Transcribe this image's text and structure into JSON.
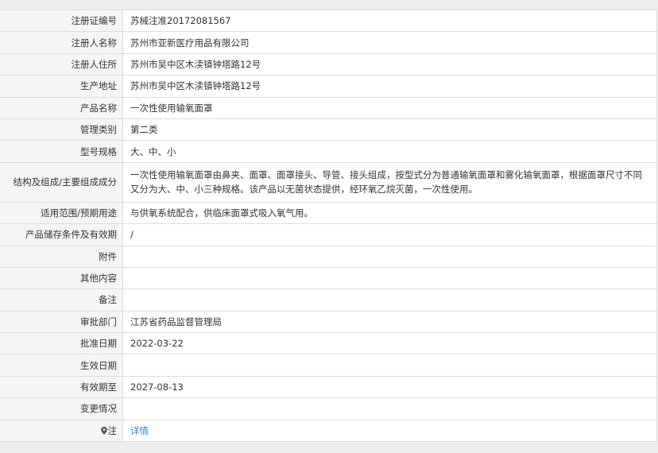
{
  "rows": [
    {
      "label": "注册证编号",
      "value": "苏械注准20172081567"
    },
    {
      "label": "注册人名称",
      "value": "苏州市亚新医疗用品有限公司"
    },
    {
      "label": "注册人住所",
      "value": "苏州市吴中区木渎镇钟塔路12号"
    },
    {
      "label": "生产地址",
      "value": "苏州市吴中区木渎镇钟塔路12号"
    },
    {
      "label": "产品名称",
      "value": "一次性使用输氧面罩"
    },
    {
      "label": "管理类别",
      "value": "第二类"
    },
    {
      "label": "型号规格",
      "value": "大、中、小"
    },
    {
      "label": "结构及组成/主要组成成分",
      "value": "一次性使用输氧面罩由鼻夹、面罩、面罩接头、导管、接头组成，按型式分为普通输氧面罩和雾化输氧面罩，根据面罩尺寸不同又分为大、中、小三种规格。该产品以无菌状态提供，经环氧乙烷灭菌，一次性使用。"
    },
    {
      "label": "适用范围/预期用途",
      "value": "与供氧系统配合，供临床面罩式吸入氧气用。"
    },
    {
      "label": "产品储存条件及有效期",
      "value": "/"
    },
    {
      "label": "附件",
      "value": ""
    },
    {
      "label": "其他内容",
      "value": ""
    },
    {
      "label": "备注",
      "value": ""
    },
    {
      "label": "审批部门",
      "value": "江苏省药品监督管理局"
    },
    {
      "label": "批准日期",
      "value": "2022-03-22"
    },
    {
      "label": "生效日期",
      "value": ""
    },
    {
      "label": "有效期至",
      "value": "2027-08-13"
    },
    {
      "label": "变更情况",
      "value": ""
    }
  ],
  "note": {
    "icon": "map-pin-icon",
    "label": "注",
    "link_text": "详情"
  },
  "colors": {
    "label_bg": "#f5f5f5",
    "border": "#dddddd",
    "link": "#3a80c9",
    "text": "#333333"
  }
}
